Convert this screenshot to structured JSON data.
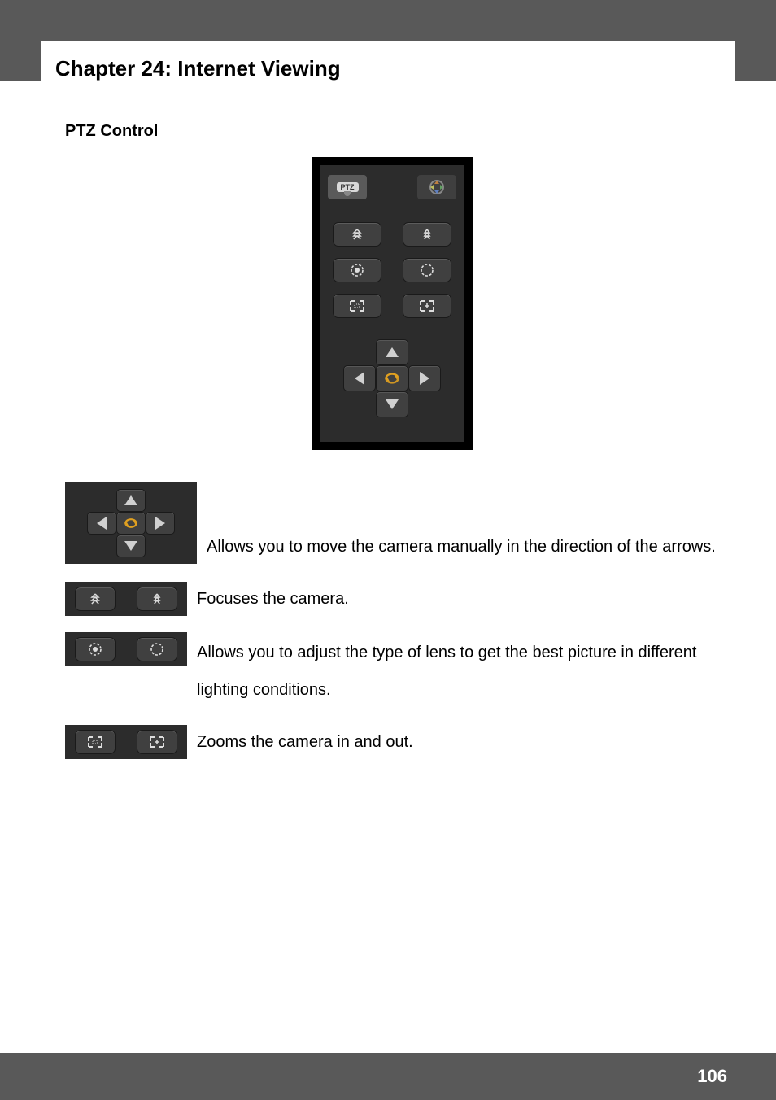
{
  "chapter_title": "Chapter 24: Internet Viewing",
  "section_title": "PTZ Control",
  "ptz_tab_label": "PTZ",
  "descriptions": {
    "dpad": "Allows you to move the camera manually in the direction of the arrows.",
    "focus": "Focuses the camera.",
    "iris": "Allows you to adjust the type of lens to get the best picture in different lighting conditions.",
    "zoom": "Zooms the camera in and out."
  },
  "page_number": "106"
}
